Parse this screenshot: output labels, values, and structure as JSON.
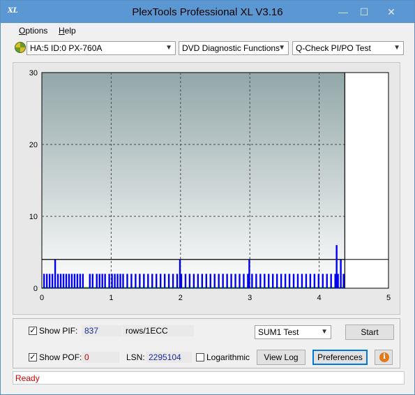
{
  "window": {
    "title": "PlexTools Professional XL V3.16",
    "icon_text": "XL",
    "controls": {
      "minimize": "—",
      "maximize": "☐",
      "close": "✕"
    }
  },
  "menu": {
    "items": [
      "Options",
      "Help"
    ]
  },
  "toolbar": {
    "drive": "HA:5 ID:0  PX-760A",
    "function": "DVD Diagnostic Functions",
    "test": "Q-Check PI/PO Test"
  },
  "chart_data": {
    "type": "bar",
    "xlim": [
      0,
      5
    ],
    "ylim": [
      0,
      30
    ],
    "x_ticks": [
      "0",
      "1",
      "2",
      "3",
      "4",
      "5"
    ],
    "y_ticks": [
      "0",
      "10",
      "20",
      "30"
    ],
    "grid": true,
    "threshold_line": 4,
    "progress_marker_x": 4.37,
    "series": [
      {
        "color": "#0000ee",
        "x": [
          0.02,
          0.06,
          0.1,
          0.14,
          0.18,
          0.22,
          0.26,
          0.3,
          0.34,
          0.38,
          0.42,
          0.46,
          0.5,
          0.54,
          0.58,
          0.68,
          0.72,
          0.78,
          0.82,
          0.86,
          0.9,
          0.96,
          1.0,
          1.04,
          1.08,
          1.12,
          1.16,
          1.22,
          1.28,
          1.34,
          1.4,
          1.46,
          1.52,
          1.58,
          1.64,
          1.7,
          1.76,
          1.82,
          1.88,
          1.94,
          1.98,
          2.0,
          2.06,
          2.12,
          2.18,
          2.24,
          2.3,
          2.36,
          2.42,
          2.48,
          2.54,
          2.6,
          2.66,
          2.72,
          2.78,
          2.84,
          2.9,
          2.96,
          2.98,
          3.02,
          3.08,
          3.14,
          3.2,
          3.26,
          3.32,
          3.38,
          3.44,
          3.5,
          3.56,
          3.62,
          3.68,
          3.74,
          3.8,
          3.86,
          3.92,
          3.98,
          4.04,
          4.1,
          4.16,
          4.22,
          4.24,
          4.26,
          4.3,
          4.34
        ],
        "values": [
          1,
          1,
          1,
          1,
          2,
          1,
          1,
          1,
          1,
          1,
          1,
          1,
          1,
          1,
          1,
          1,
          1,
          1,
          1,
          1,
          1,
          1,
          1,
          1,
          1,
          1,
          1,
          1,
          1,
          1,
          1,
          1,
          1,
          1,
          1,
          1,
          1,
          1,
          1,
          1,
          2,
          1,
          1,
          1,
          1,
          1,
          1,
          1,
          1,
          1,
          1,
          1,
          1,
          1,
          1,
          1,
          1,
          1,
          2,
          1,
          1,
          1,
          1,
          1,
          1,
          1,
          1,
          1,
          1,
          1,
          1,
          1,
          1,
          1,
          1,
          1,
          1,
          1,
          1,
          1,
          3,
          1,
          2,
          1
        ]
      }
    ]
  },
  "controls_panel": {
    "show_pif_label": "Show PIF:",
    "pif_value": "837",
    "pif_unit": "rows/1ECC",
    "show_pof_label": "Show POF:",
    "pof_value": "0",
    "lsn_label": "LSN:",
    "lsn_value": "2295104",
    "logarithmic_label": "Logarithmic",
    "test_select": "SUM1 Test",
    "start_label": "Start",
    "view_log_label": "View Log",
    "preferences_label": "Preferences",
    "info_glyph": "i",
    "check_glyph": "✓"
  },
  "status": {
    "text": "Ready"
  }
}
